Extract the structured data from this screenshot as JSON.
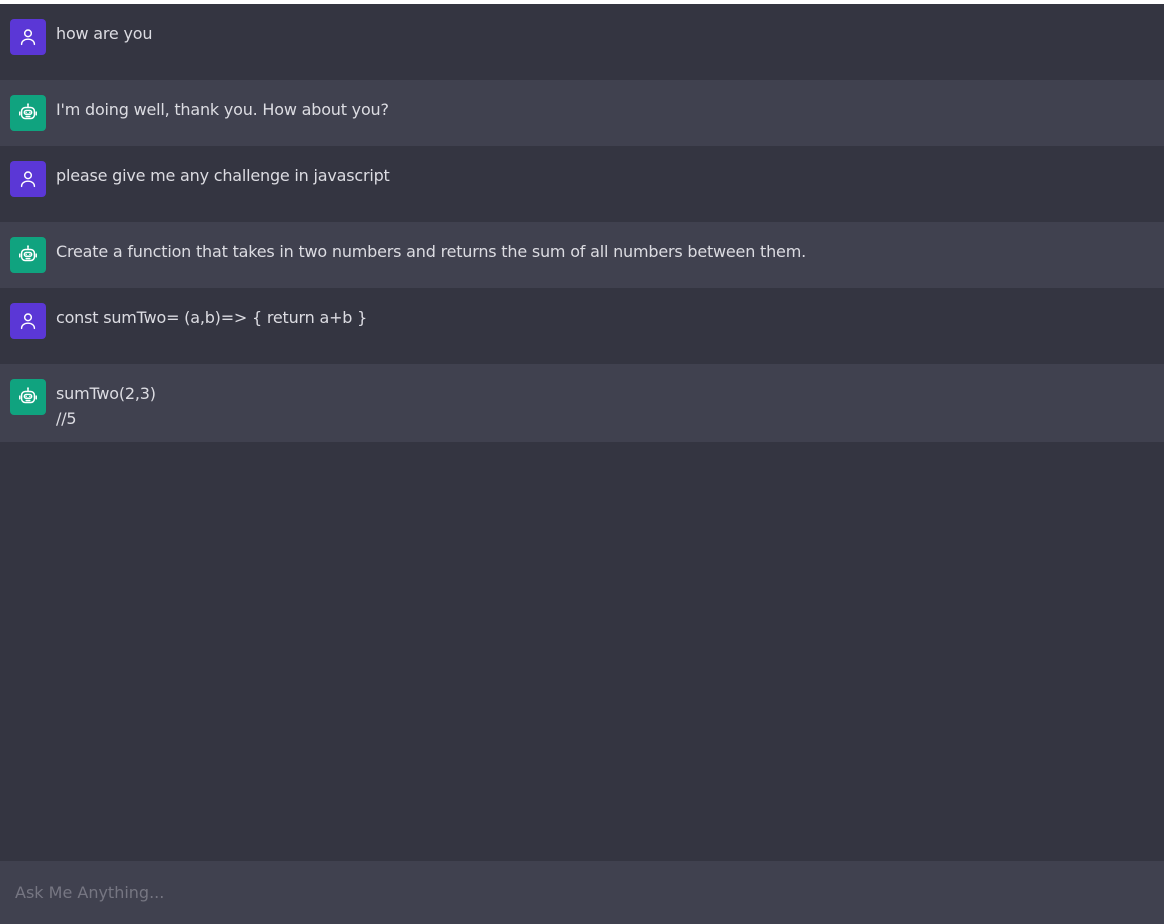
{
  "colors": {
    "background": "#343541",
    "ai_row": "#40414f",
    "user_avatar": "#5b37d6",
    "ai_avatar": "#10a37f",
    "text": "#dcdce2",
    "placeholder": "#767682"
  },
  "messages": [
    {
      "role": "user",
      "icon": "user-icon",
      "text": "how are you"
    },
    {
      "role": "ai",
      "icon": "bot-icon",
      "text": "I'm doing well, thank you. How about you?"
    },
    {
      "role": "user",
      "icon": "user-icon",
      "text": "please give me any challenge in javascript"
    },
    {
      "role": "ai",
      "icon": "bot-icon",
      "text": "Create a function that takes in two numbers and returns the sum of all numbers between them."
    },
    {
      "role": "user",
      "icon": "user-icon",
      "text": "const sumTwo= (a,b)=> { return a+b }"
    },
    {
      "role": "ai",
      "icon": "bot-icon",
      "text": "sumTwo(2,3)\n//5"
    }
  ],
  "composer": {
    "placeholder": "Ask Me Anything..."
  }
}
